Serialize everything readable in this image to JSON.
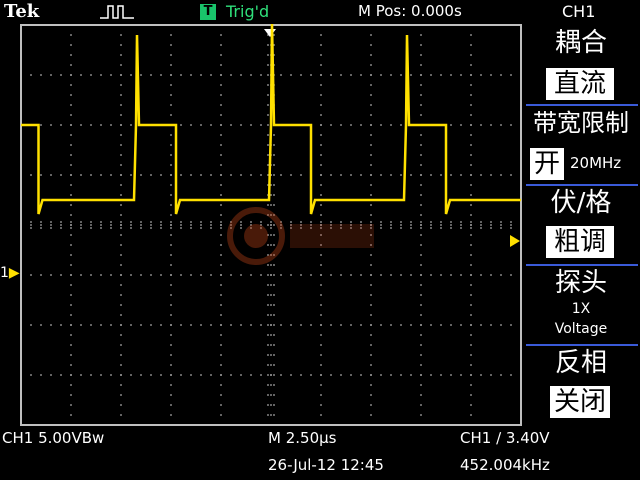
{
  "header": {
    "brand": "Tek",
    "trigger_badge": "T",
    "trigger_status": "Trig'd",
    "main_position": "M Pos: 0.000s",
    "active_channel": "CH1"
  },
  "channel_marker": "1",
  "side_menu": {
    "coupling": {
      "title": "耦合",
      "value": "直流"
    },
    "bandwidth_limit": {
      "title": "带宽限制",
      "value": "开",
      "extra": "20MHz"
    },
    "volts_div": {
      "title": "伏/格",
      "value": "粗调"
    },
    "probe": {
      "title": "探头",
      "attenuation": "1X",
      "type": "Voltage"
    },
    "invert": {
      "title": "反相",
      "value": "关闭"
    }
  },
  "status_bar": {
    "ch1_scale": "CH1  5.00VBw",
    "timebase": "M 2.50µs",
    "trigger": "CH1 ∕ 3.40V",
    "datetime": "26-Jul-12 12:45",
    "frequency": "452.004kHz"
  },
  "colors": {
    "trace": "#ffe000",
    "trigger_text": "#2fe07b",
    "menu_separator": "#3a5ad8"
  },
  "waveform": {
    "low_level_div": 0.5,
    "high_level_div": 2.0,
    "periods": [
      {
        "rise": 2.3,
        "fall": 3.1
      },
      {
        "rise": 5.0,
        "fall": 5.8
      },
      {
        "rise": 7.7,
        "fall": 8.5
      }
    ],
    "spike_level_div": 3.8,
    "pre_trigger_high_end": 0.35
  }
}
